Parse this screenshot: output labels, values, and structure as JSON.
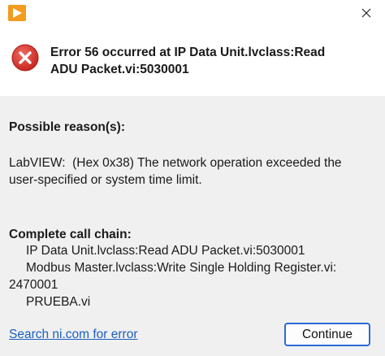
{
  "window": {
    "app_icon": "labview-play-icon",
    "close_icon": "close-icon"
  },
  "header": {
    "icon": "error-x-icon",
    "title_line1": "Error 56 occurred at IP Data Unit.lvclass:Read",
    "title_line2": "ADU Packet.vi:5030001"
  },
  "reason": {
    "heading": "Possible reason(s):",
    "text_line1": "LabVIEW:  (Hex 0x38) The network operation exceeded the",
    "text_line2": "user-specified or system time limit."
  },
  "call_chain": {
    "heading": "Complete call chain:",
    "items": [
      "IP Data Unit.lvclass:Read ADU Packet.vi:5030001",
      "Modbus Master.lvclass:Write Single Holding Register.vi:",
      "2470001",
      "PRUEBA.vi"
    ]
  },
  "footer": {
    "search_link": "Search ni.com for error",
    "continue_label": "Continue"
  },
  "colors": {
    "error_red": "#d9342b",
    "link_blue": "#1a5fbf",
    "button_border": "#2a6ad6",
    "app_icon_orange": "#f29b1d"
  }
}
